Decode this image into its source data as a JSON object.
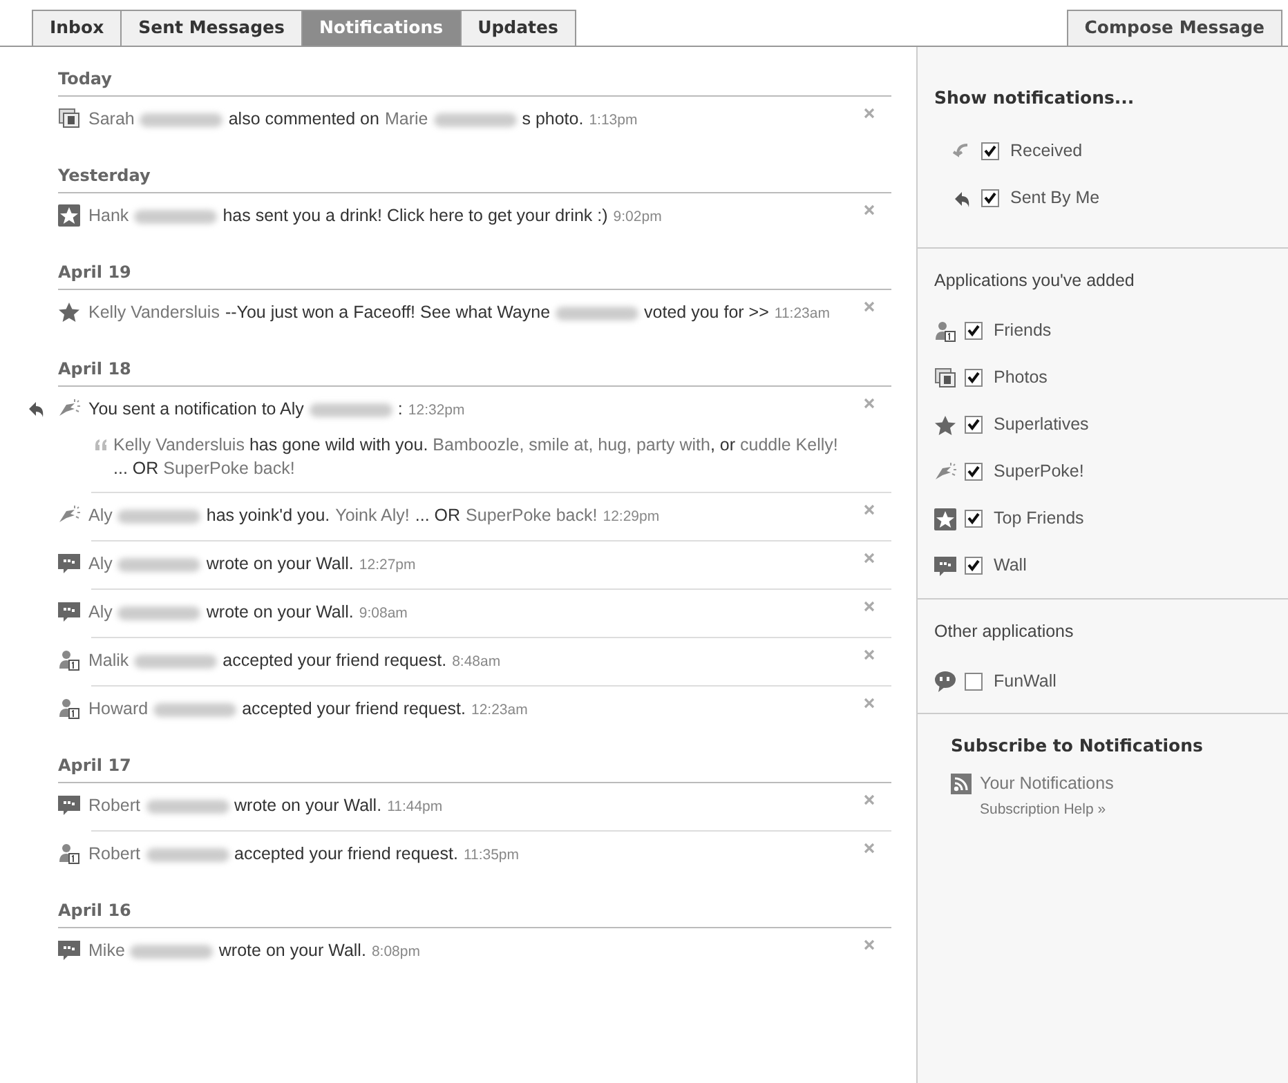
{
  "tabs": [
    {
      "label": "Inbox",
      "selected": false
    },
    {
      "label": "Sent Messages",
      "selected": false
    },
    {
      "label": "Notifications",
      "selected": true
    },
    {
      "label": "Updates",
      "selected": false
    }
  ],
  "compose_button": "Compose Message",
  "notification_groups": [
    {
      "date": "Today",
      "items": [
        {
          "kind": "photos",
          "sent": false,
          "segments": [
            {
              "kind": "name",
              "text": "Sarah"
            },
            {
              "kind": "blur"
            },
            {
              "kind": "text",
              "text": "also commented on"
            },
            {
              "kind": "name",
              "text": "Marie"
            },
            {
              "kind": "blur"
            },
            {
              "kind": "text",
              "text": "s photo."
            },
            {
              "kind": "time",
              "text": "1:13pm"
            }
          ]
        }
      ]
    },
    {
      "date": "Yesterday",
      "items": [
        {
          "kind": "topfriends",
          "sent": false,
          "segments": [
            {
              "kind": "name",
              "text": "Hank"
            },
            {
              "kind": "blur"
            },
            {
              "kind": "text",
              "text": "has sent you a drink! Click here to get your drink :)"
            },
            {
              "kind": "time",
              "text": "9:02pm"
            }
          ]
        }
      ]
    },
    {
      "date": "April 19",
      "items": [
        {
          "kind": "superlatives",
          "sent": false,
          "segments": [
            {
              "kind": "name",
              "text": "Kelly Vandersluis"
            },
            {
              "kind": "text",
              "text": "--You just won a Faceoff! See what Wayne"
            },
            {
              "kind": "blur"
            },
            {
              "kind": "text",
              "text": "voted you for >>"
            },
            {
              "kind": "time",
              "text": "11:23am"
            }
          ]
        }
      ]
    },
    {
      "date": "April 18",
      "items": [
        {
          "kind": "superpoke",
          "sent": true,
          "segments": [
            {
              "kind": "text",
              "text": "You sent a notification to Aly"
            },
            {
              "kind": "blur"
            },
            {
              "kind": "text",
              "text": ":"
            },
            {
              "kind": "time",
              "text": "12:32pm"
            }
          ],
          "quote": "Kelly Vandersluis **has gone wild with you.** Bamboozle, smile at, hug, party with**, or** cuddle Kelly! **... OR** SuperPoke back!"
        },
        {
          "kind": "superpoke",
          "sent": false,
          "segments": [
            {
              "kind": "name",
              "text": "Aly"
            },
            {
              "kind": "blur"
            },
            {
              "kind": "text",
              "text": "has yoink'd you."
            },
            {
              "kind": "name",
              "text": "Yoink Aly!"
            },
            {
              "kind": "text",
              "text": "... OR"
            },
            {
              "kind": "name",
              "text": "SuperPoke back!"
            },
            {
              "kind": "time",
              "text": "12:29pm"
            }
          ]
        },
        {
          "kind": "wall",
          "sent": false,
          "segments": [
            {
              "kind": "name",
              "text": "Aly"
            },
            {
              "kind": "blur"
            },
            {
              "kind": "text",
              "text": "wrote on your Wall."
            },
            {
              "kind": "time",
              "text": "12:27pm"
            }
          ]
        },
        {
          "kind": "wall",
          "sent": false,
          "segments": [
            {
              "kind": "name",
              "text": "Aly"
            },
            {
              "kind": "blur"
            },
            {
              "kind": "text",
              "text": "wrote on your Wall."
            },
            {
              "kind": "time",
              "text": "9:08am"
            }
          ]
        },
        {
          "kind": "friends",
          "sent": false,
          "segments": [
            {
              "kind": "name",
              "text": "Malik"
            },
            {
              "kind": "blur"
            },
            {
              "kind": "text",
              "text": "accepted your friend request."
            },
            {
              "kind": "time",
              "text": "8:48am"
            }
          ]
        },
        {
          "kind": "friends",
          "sent": false,
          "segments": [
            {
              "kind": "name",
              "text": "Howard"
            },
            {
              "kind": "blur"
            },
            {
              "kind": "text",
              "text": "accepted your friend request."
            },
            {
              "kind": "time",
              "text": "12:23am"
            }
          ]
        }
      ]
    },
    {
      "date": "April 17",
      "items": [
        {
          "kind": "wall",
          "sent": false,
          "segments": [
            {
              "kind": "name",
              "text": "Robert"
            },
            {
              "kind": "blur"
            },
            {
              "kind": "text",
              "text": "wrote on your Wall."
            },
            {
              "kind": "time",
              "text": "11:44pm"
            }
          ]
        },
        {
          "kind": "friends",
          "sent": false,
          "segments": [
            {
              "kind": "name",
              "text": "Robert"
            },
            {
              "kind": "blur"
            },
            {
              "kind": "text",
              "text": "accepted your friend request."
            },
            {
              "kind": "time",
              "text": "11:35pm"
            }
          ]
        }
      ]
    },
    {
      "date": "April 16",
      "items": [
        {
          "kind": "wall",
          "sent": false,
          "segments": [
            {
              "kind": "name",
              "text": "Mike"
            },
            {
              "kind": "blur"
            },
            {
              "kind": "text",
              "text": "wrote on your Wall."
            },
            {
              "kind": "time",
              "text": "8:08pm"
            }
          ]
        }
      ]
    }
  ],
  "filter_sections": [
    {
      "heading": "Show notifications...",
      "kind": "primary",
      "items": [
        {
          "kind": "received",
          "label": "Received",
          "checked": true
        },
        {
          "kind": "sent",
          "label": "Sent By Me",
          "checked": true
        }
      ]
    },
    {
      "heading": "Applications you've added",
      "kind": "secondary",
      "items": [
        {
          "kind": "friends",
          "label": "Friends",
          "checked": true
        },
        {
          "kind": "photos",
          "label": "Photos",
          "checked": true
        },
        {
          "kind": "superlatives",
          "label": "Superlatives",
          "checked": true
        },
        {
          "kind": "superpoke",
          "label": "SuperPoke!",
          "checked": true
        },
        {
          "kind": "topfriends",
          "label": "Top Friends",
          "checked": true
        },
        {
          "kind": "wall",
          "label": "Wall",
          "checked": true
        }
      ]
    },
    {
      "heading": "Other applications",
      "kind": "secondary",
      "items": [
        {
          "kind": "funwall",
          "label": "FunWall",
          "checked": false
        }
      ]
    }
  ],
  "subscribe": {
    "title": "Subscribe to Notifications",
    "link": "Your Notifications",
    "help": "Subscription Help »"
  }
}
